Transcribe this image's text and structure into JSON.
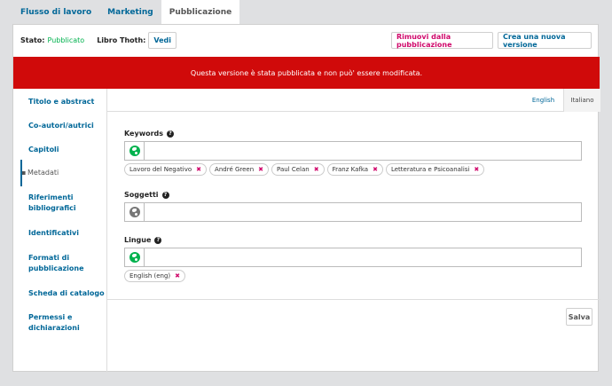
{
  "top_tabs": [
    "Flusso di lavoro",
    "Marketing",
    "Pubblicazione"
  ],
  "status": {
    "label": "Stato:",
    "value": "Pubblicato",
    "thoth_label": "Libro Thoth:",
    "vedi": "Vedi",
    "remove_button": "Rimuovi dalla pubblicazione",
    "new_version_button": "Crea una nuova versione"
  },
  "alert": "Questa versione è stata pubblicata e non può' essere modificata.",
  "sidebar": {
    "items": [
      "Titolo e abstract",
      "Co-autori/autrici",
      "Capitoli",
      "Metadati",
      "Riferimenti bibliografici",
      "Identificativi",
      "Formati di pubblicazione",
      "Scheda di catalogo",
      "Permessi e dichiarazioni"
    ]
  },
  "languages": {
    "english": "English",
    "italiano": "Italiano"
  },
  "fields": {
    "keywords": {
      "label": "Keywords",
      "help": "?",
      "tags": [
        "Lavoro del Negativo",
        "André Green",
        "Paul Celan",
        "Franz Kafka",
        "Letteratura e Psicoanalisi"
      ]
    },
    "soggetti": {
      "label": "Soggetti",
      "help": "?"
    },
    "lingue": {
      "label": "Lingue",
      "help": "?",
      "tags": [
        "English (eng)"
      ]
    }
  },
  "tag_remove": "✖",
  "save_button": "Salva",
  "colors": {
    "link": "#006798",
    "alert": "#d00a0a",
    "published": "#00b24e",
    "remove": "#d00a6c"
  }
}
